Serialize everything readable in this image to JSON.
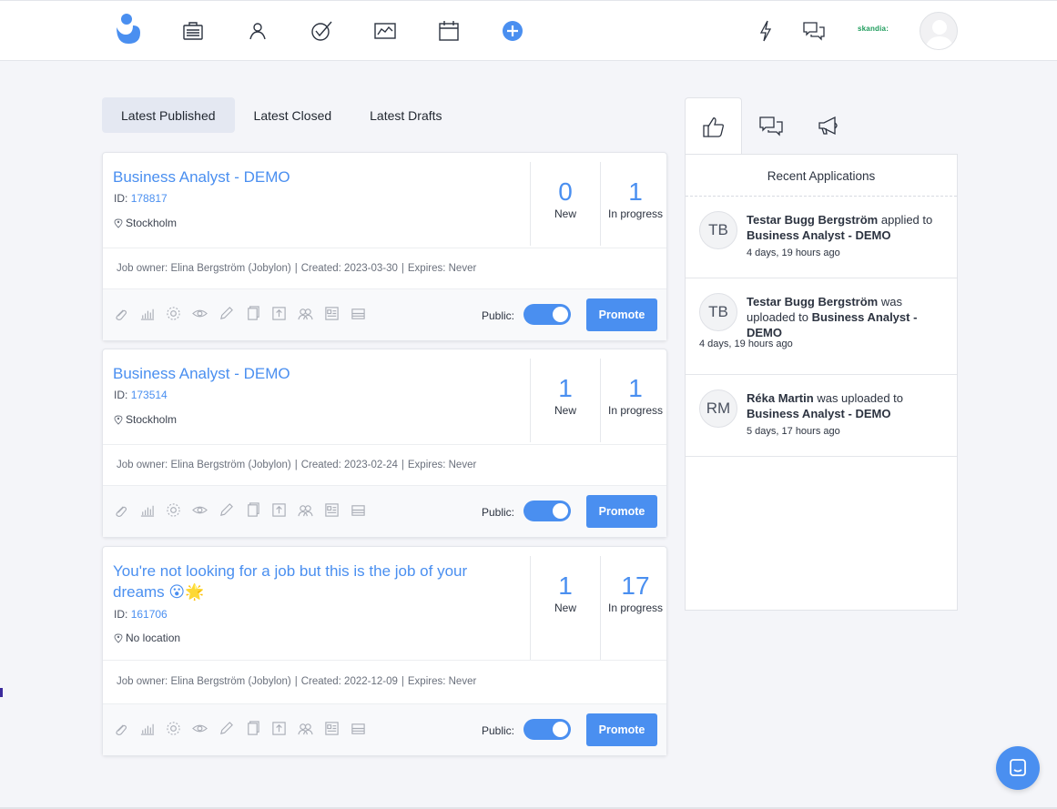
{
  "nav": {
    "icons": [
      "briefcase-icon",
      "user-icon",
      "check-icon",
      "chart-icon",
      "calendar-icon",
      "plus-circle-icon"
    ],
    "right_icons": [
      "bolt-icon",
      "chat-icon"
    ],
    "brand": "skandia:",
    "accent": "#4a8ff0"
  },
  "tabs": {
    "published": "Latest Published",
    "closed": "Latest Closed",
    "drafts": "Latest Drafts"
  },
  "labels": {
    "id_prefix": "ID:",
    "new": "New",
    "in_progress": "In progress",
    "public": "Public:",
    "promote": "Promote"
  },
  "jobs": [
    {
      "title": "Business Analyst - DEMO",
      "id": "178817",
      "location": "Stockholm",
      "new_count": "0",
      "in_progress_count": "1",
      "owner": "Job owner: Elina Bergström (Jobylon)",
      "created": "Created: 2023-03-30",
      "expires": "Expires: Never",
      "public": true
    },
    {
      "title": "Business Analyst - DEMO",
      "id": "173514",
      "location": "Stockholm",
      "new_count": "1",
      "in_progress_count": "1",
      "owner": "Job owner: Elina Bergström (Jobylon)",
      "created": "Created: 2023-02-24",
      "expires": "Expires: Never",
      "public": true
    },
    {
      "title": "You're not looking for a job but this is the job of your dreams 😮🌟",
      "id": "161706",
      "location": "No location",
      "new_count": "1",
      "in_progress_count": "17",
      "owner": "Job owner: Elina Bergström (Jobylon)",
      "created": "Created: 2022-12-09",
      "expires": "Expires: Never",
      "public": true
    }
  ],
  "right_panel": {
    "heading": "Recent Applications",
    "items": [
      {
        "initials": "TB",
        "name": "Testar Bugg Bergström",
        "action": "applied to",
        "job": "Business Analyst - DEMO",
        "time": "4 days, 19 hours ago"
      },
      {
        "initials": "TB",
        "name": "Testar Bugg Bergström",
        "action": "was uploaded to",
        "job": "Business Analyst - DEMO",
        "time": "4 days, 19 hours ago"
      },
      {
        "initials": "RM",
        "name": "Réka Martin",
        "action": "was uploaded to",
        "job": "Business Analyst - DEMO",
        "time": "5 days, 17 hours ago"
      }
    ]
  }
}
